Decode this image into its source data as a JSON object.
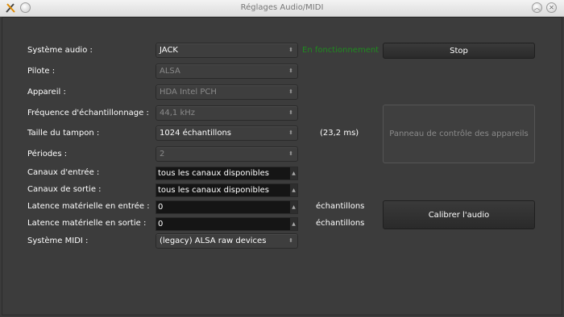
{
  "window": {
    "title": "Réglages Audio/MIDI",
    "close_glyph": "✕",
    "min_glyph": "︿"
  },
  "form": {
    "audio_system": {
      "label": "Système audio :",
      "value": "JACK"
    },
    "driver": {
      "label": "Pilote :",
      "value": "ALSA"
    },
    "device": {
      "label": "Appareil :",
      "value": "HDA Intel PCH"
    },
    "sample_rate": {
      "label": "Fréquence d'échantillonnage :",
      "value": "44,1 kHz"
    },
    "buffer_size": {
      "label": "Taille du tampon :",
      "value": "1024 échantillons",
      "latency": "(23,2 ms)"
    },
    "periods": {
      "label": "Périodes :",
      "value": "2"
    },
    "input_channels": {
      "label": "Canaux d'entrée :",
      "value": "tous les canaux disponibles"
    },
    "output_channels": {
      "label": "Canaux de sortie :",
      "value": "tous les canaux disponibles"
    },
    "input_latency": {
      "label": "Latence matérielle en entrée :",
      "value": "0",
      "unit": "échantillons"
    },
    "output_latency": {
      "label": "Latence matérielle en sortie :",
      "value": "0",
      "unit": "échantillons"
    },
    "midi_system": {
      "label": "Système MIDI :",
      "value": "(legacy) ALSA raw devices"
    }
  },
  "status": {
    "running": "En fonctionnement"
  },
  "buttons": {
    "stop": "Stop",
    "control_panel": "Panneau de contrôle des appareils",
    "calibrate": "Calibrer l'audio"
  },
  "icons": {
    "combo_arrows": "⬍",
    "spin_up": "▲",
    "spin_down": "▼"
  },
  "colors": {
    "status_running": "#1f8a1f",
    "background": "#3b3b3b"
  }
}
